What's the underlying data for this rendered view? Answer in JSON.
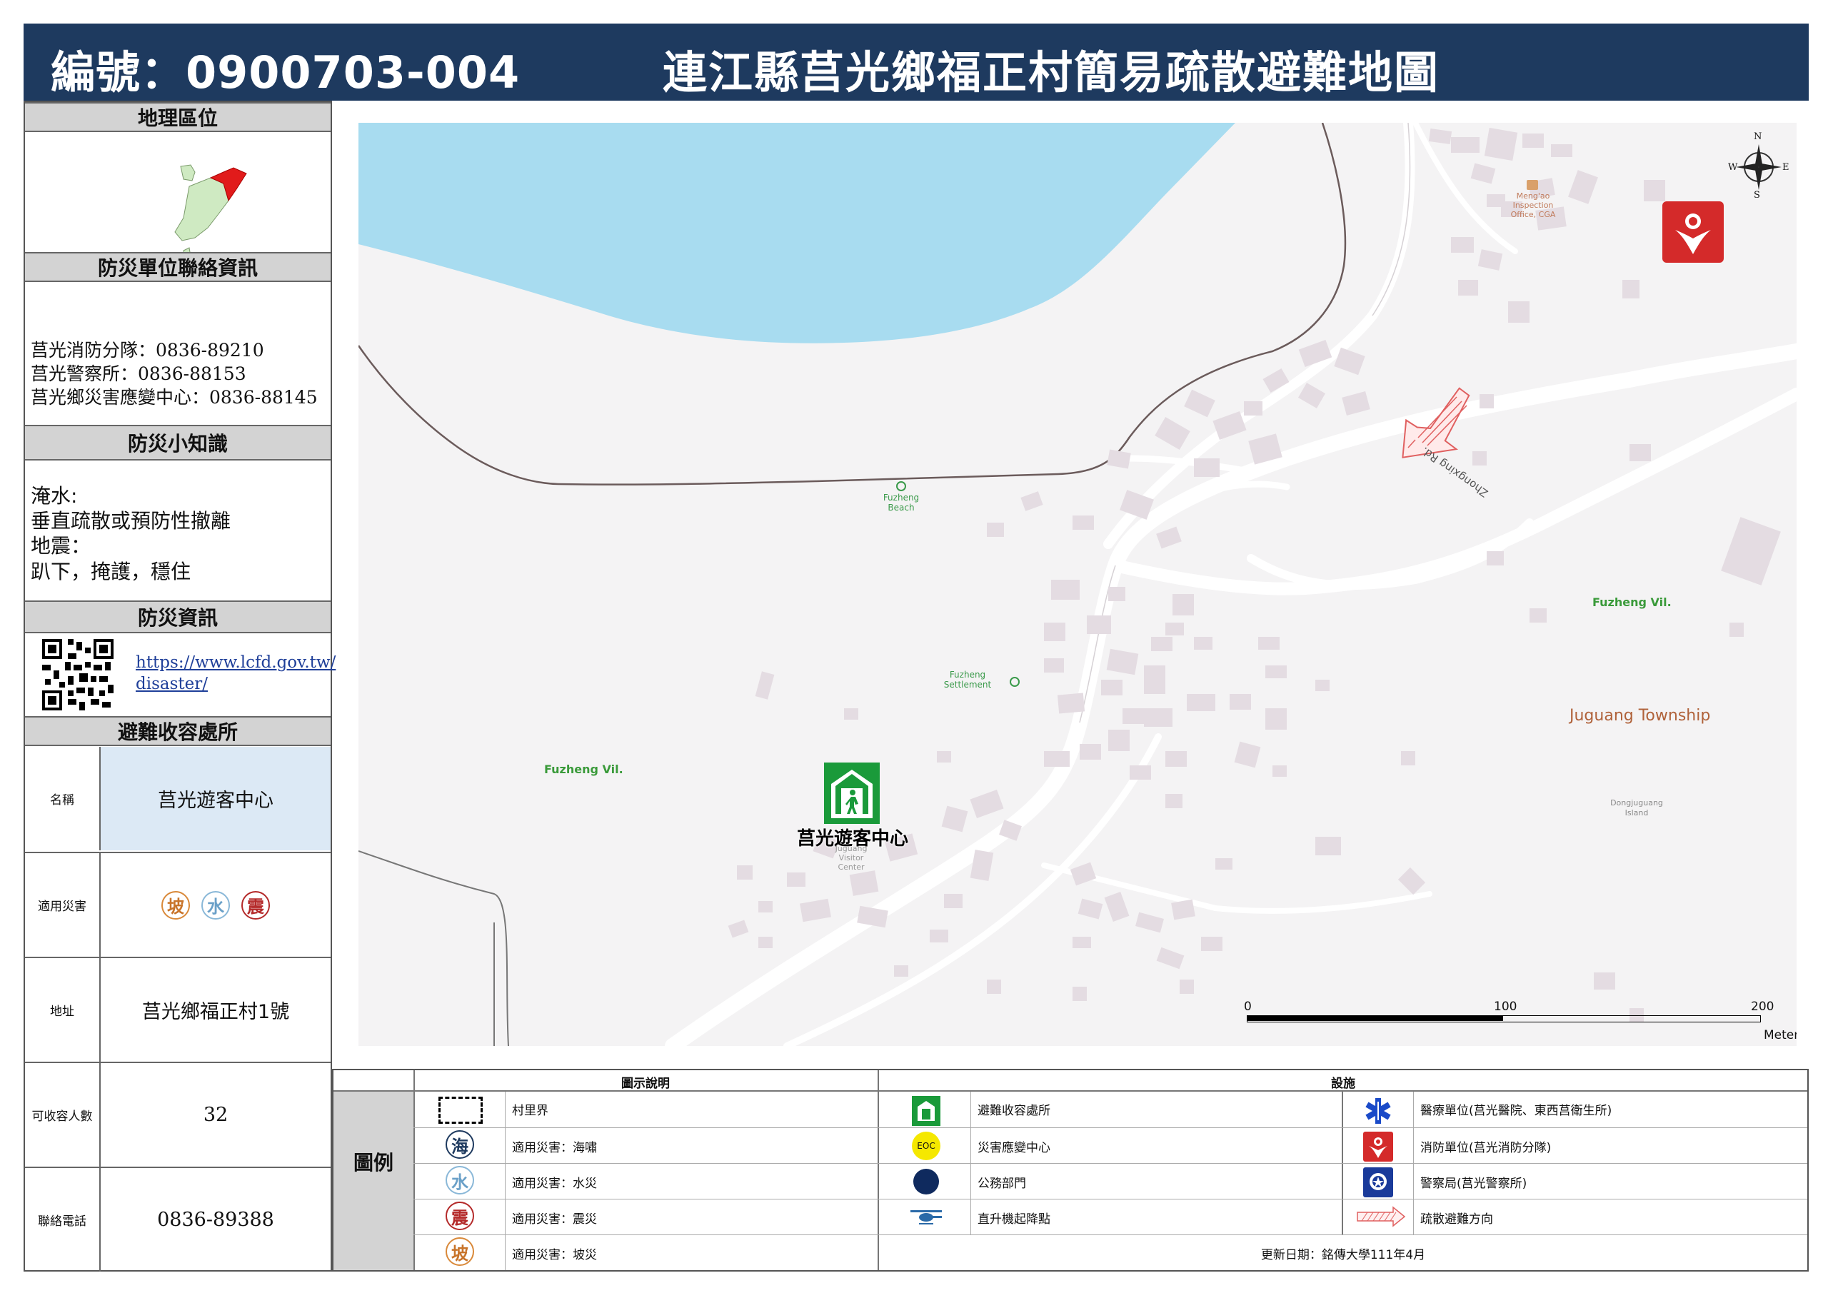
{
  "header": {
    "code": "編號：0900703-004",
    "title": "連江縣莒光鄉福正村簡易疏散避難地圖"
  },
  "sidebar": {
    "location_head": "地理區位",
    "contacts_head": "防災單位聯絡資訊",
    "contacts": [
      "莒光消防分隊：0836-89210",
      "莒光警察所：0836-88153",
      "莒光鄉災害應變中心：0836-88145"
    ],
    "tips_head": "防災小知識",
    "tips": [
      "淹水:",
      "垂直疏散或預防性撤離",
      "地震：",
      "趴下，掩護，穩住"
    ],
    "info_head": "防災資訊",
    "url_lines": [
      "https://www.lcfd.gov.tw/",
      "disaster/"
    ],
    "shelter_head": "避難收容處所",
    "shelter": {
      "name_label": "名稱",
      "name": "莒光遊客中心",
      "hazard_label": "適用災害",
      "hazards": [
        "坡",
        "水",
        "震"
      ],
      "address_label": "地址",
      "address": "莒光鄉福正村1號",
      "capacity_label": "可收容人數",
      "capacity": "32",
      "phone_label": "聯絡電話",
      "phone": "0836-89388"
    }
  },
  "map": {
    "labels": {
      "shelter": "莒光遊客中心",
      "visitor_en": [
        "Juguang",
        "Visitor",
        "Center"
      ],
      "beach": [
        "Fuzheng",
        "Beach"
      ],
      "settlement": [
        "Fuzheng",
        "Settlement"
      ],
      "village_left": "Fuzheng Vil.",
      "village_right": "Fuzheng Vil.",
      "township": "Juguang Township",
      "island": [
        "Dongjuguang",
        "Island"
      ],
      "office": [
        "Meng'ao",
        "Inspection",
        "Office, CGA"
      ],
      "road": "Zhongxing Rd."
    },
    "compass": {
      "n": "N",
      "s": "S",
      "e": "E",
      "w": "W"
    },
    "scale": {
      "ticks": [
        "0",
        "100",
        "200"
      ],
      "unit": "Meters"
    }
  },
  "legend": {
    "title": "圖例",
    "col1_head": "圖示說明",
    "col2_head": "設施",
    "items_left": [
      "村里界",
      "適用災害：海嘯",
      "適用災害：水災",
      "適用災害：震災",
      "適用災害：坡災"
    ],
    "left_icons": [
      "海",
      "水",
      "震",
      "坡"
    ],
    "items_mid": [
      "避難收容處所",
      "災害應變中心",
      "公務部門",
      "直升機起降點"
    ],
    "eoc": "EOC",
    "items_right": [
      "醫療單位(莒光醫院、東西莒衛生所)",
      "消防單位(莒光消防分隊)",
      "警察局(莒光警察所)",
      "疏散避難方向"
    ],
    "update": "更新日期：銘傳大學111年4月"
  },
  "colors": {
    "header_bg": "#1e3a5f",
    "sea": "#a8dcf0",
    "land": "#f4f3f4",
    "building": "#e4dce2",
    "shelter_green": "#1a9a3a",
    "fire_red": "#d42a2a",
    "evac_arrow": "#e06060"
  }
}
